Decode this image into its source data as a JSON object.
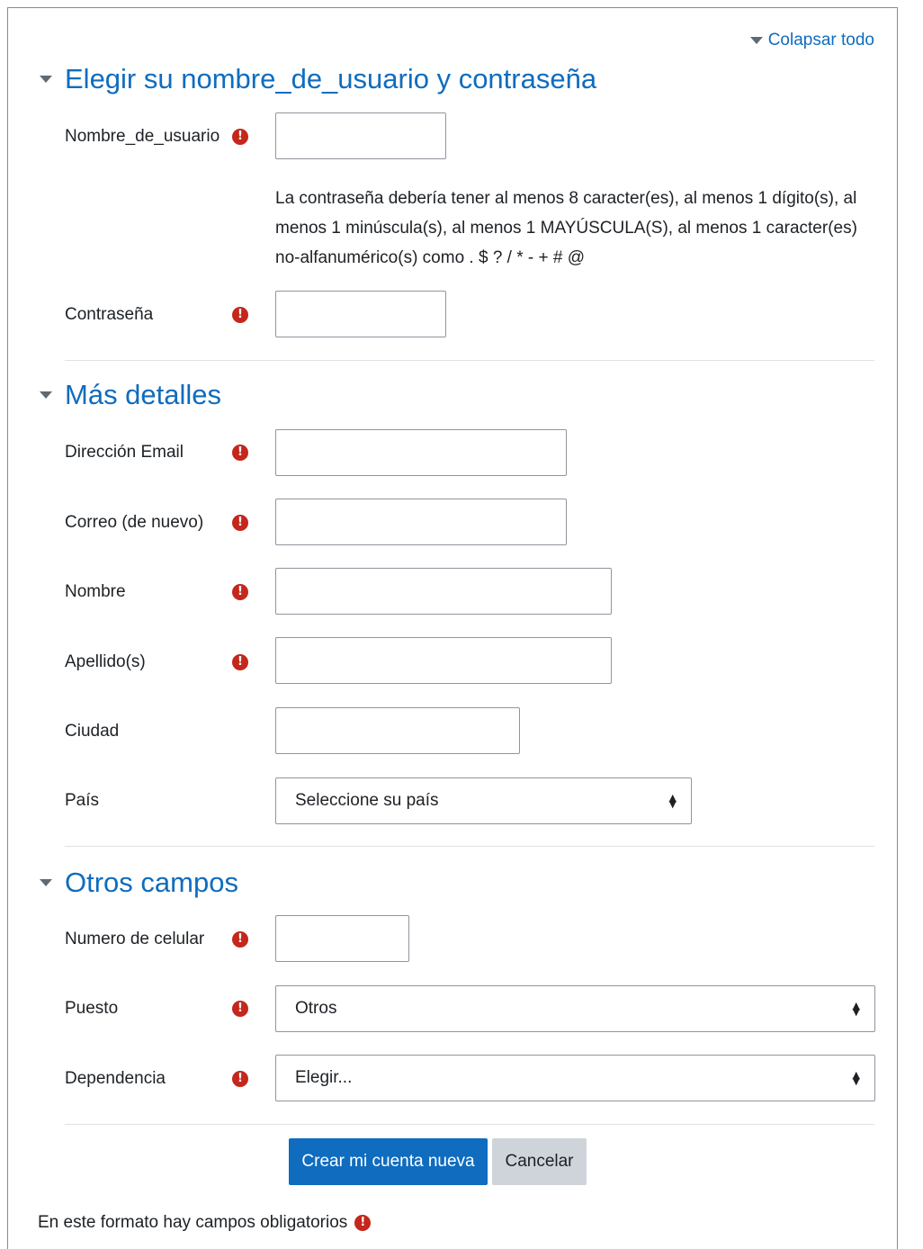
{
  "header": {
    "collapse_all": "Colapsar todo"
  },
  "sections": {
    "account": {
      "title": "Elegir su nombre_de_usuario y contraseña",
      "username_label": "Nombre_de_usuario",
      "username_value": "",
      "password_help": "La contraseña debería tener al menos 8 caracter(es), al menos 1 dígito(s), al menos 1 minúscula(s), al menos 1 MAYÚSCULA(S), al menos 1 caracter(es) no-alfanumérico(s) como . $ ? / * - + # @",
      "password_label": "Contraseña",
      "password_value": ""
    },
    "details": {
      "title": "Más detalles",
      "email_label": "Dirección Email",
      "email_value": "",
      "email2_label": "Correo (de nuevo)",
      "email2_value": "",
      "firstname_label": "Nombre",
      "firstname_value": "",
      "lastname_label": "Apellido(s)",
      "lastname_value": "",
      "city_label": "Ciudad",
      "city_value": "",
      "country_label": "País",
      "country_selected": "Seleccione su país"
    },
    "other": {
      "title": "Otros campos",
      "phone_label": "Numero de celular",
      "phone_value": "",
      "position_label": "Puesto",
      "position_selected": "Otros",
      "department_label": "Dependencia",
      "department_selected": "Elegir..."
    }
  },
  "buttons": {
    "create": "Crear mi cuenta nueva",
    "cancel": "Cancelar"
  },
  "footer": {
    "required_note": "En este formato hay campos obligatorios"
  },
  "icons": {
    "required": "exclamation-circle-icon",
    "collapse": "triangle-down-icon",
    "select": "sort-arrows-icon"
  },
  "colors": {
    "link": "#0f6cbf",
    "required": "#c4271b",
    "primary_button": "#0f6cbf",
    "secondary_button": "#ced4da"
  }
}
